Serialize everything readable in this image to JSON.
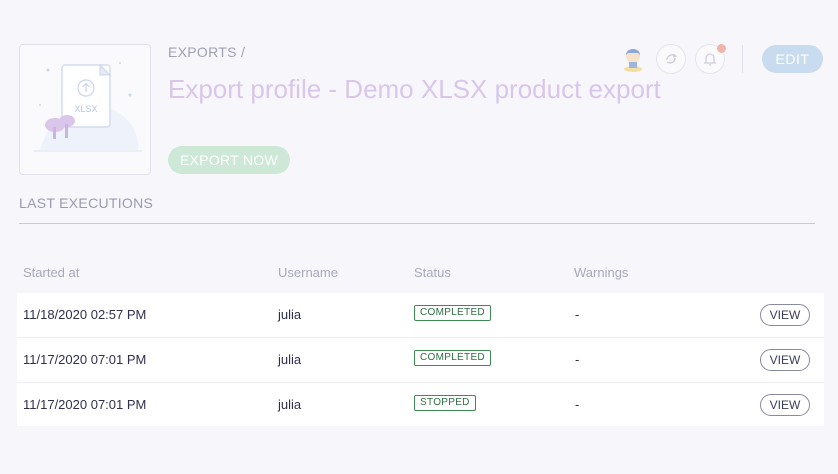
{
  "header": {
    "breadcrumb": "EXPORTS /",
    "title": "Export profile - Demo XLSX product export",
    "edit_label": "EDIT",
    "export_now_label": "EXPORT NOW",
    "illustration_file_label": "XLSX"
  },
  "section": {
    "title": "LAST EXECUTIONS"
  },
  "table": {
    "columns": [
      "Started at",
      "Username",
      "Status",
      "Warnings"
    ],
    "rows": [
      {
        "started_at": "11/18/2020 02:57 PM",
        "username": "julia",
        "status": "COMPLETED",
        "warnings": "-",
        "action": "VIEW"
      },
      {
        "started_at": "11/17/2020 07:01 PM",
        "username": "julia",
        "status": "COMPLETED",
        "warnings": "-",
        "action": "VIEW"
      },
      {
        "started_at": "11/17/2020 07:01 PM",
        "username": "julia",
        "status": "STOPPED",
        "warnings": "-",
        "action": "VIEW"
      }
    ]
  },
  "colors": {
    "title": "#d9c6ea",
    "edit_button": "#c9dbee",
    "export_button": "#cde8d6",
    "status_badge": "#3f8a54",
    "notification_dot": "#f0b4a8"
  },
  "icons": {
    "avatar": "user-avatar",
    "refresh": "refresh-icon",
    "notifications": "bell-icon",
    "illustration": "export-file-illustration"
  }
}
